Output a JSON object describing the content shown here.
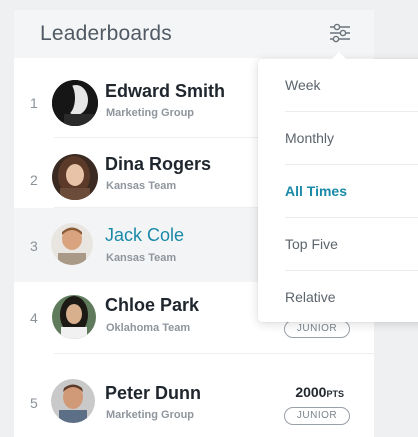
{
  "header": {
    "title": "Leaderboards",
    "filter_icon": "sliders-icon"
  },
  "colors": {
    "accent": "#1a8aa8",
    "text_dark": "#1f262d",
    "text_muted": "#8e959c"
  },
  "leaders": [
    {
      "rank": "1",
      "name": "Edward Smith",
      "team": "Marketing Group",
      "points": "",
      "points_unit": "",
      "badge": ""
    },
    {
      "rank": "2",
      "name": "Dina Rogers",
      "team": "Kansas Team",
      "points": "",
      "points_unit": "",
      "badge": ""
    },
    {
      "rank": "3",
      "name": "Jack Cole",
      "team": "Kansas Team",
      "points": "",
      "points_unit": "",
      "badge": ""
    },
    {
      "rank": "4",
      "name": "Chloe Park",
      "team": "Oklahoma Team",
      "points": "",
      "points_unit": "",
      "badge": "JUNIOR"
    },
    {
      "rank": "5",
      "name": "Peter Dunn",
      "team": "Marketing Group",
      "points": "2000",
      "points_unit": "PTS",
      "badge": "JUNIOR"
    }
  ],
  "dropdown": {
    "items": [
      "Week",
      "Monthly",
      "All Times",
      "Top Five",
      "Relative"
    ],
    "selected": "All Times"
  }
}
